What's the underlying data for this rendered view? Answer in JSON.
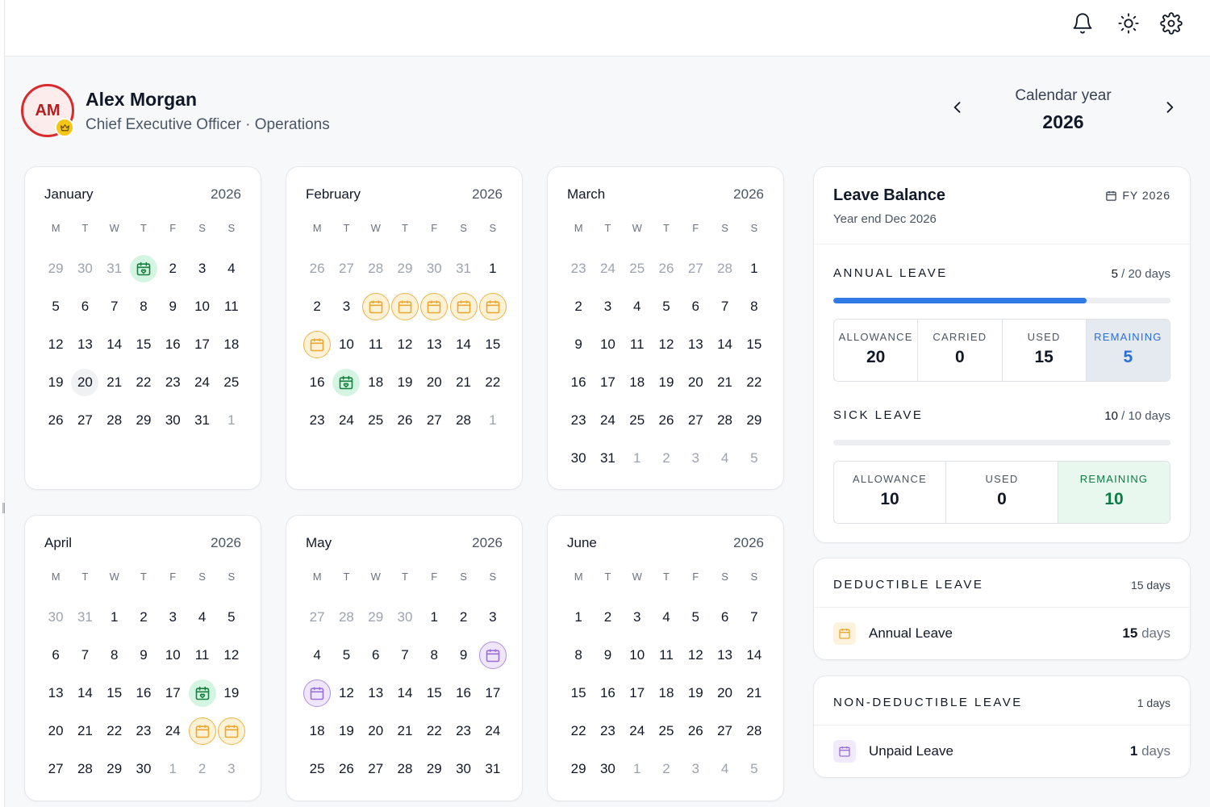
{
  "user": {
    "initials": "AM",
    "name": "Alex Morgan",
    "role": "Chief Executive Officer · Operations"
  },
  "year_nav": {
    "label": "Calendar year",
    "year": "2026"
  },
  "months": [
    {
      "name": "January",
      "year": "2026",
      "dow": [
        "M",
        "T",
        "W",
        "T",
        "F",
        "S",
        "S"
      ],
      "days": [
        {
          "d": "29",
          "m": true
        },
        {
          "d": "30",
          "m": true
        },
        {
          "d": "31",
          "m": true
        },
        {
          "d": "1",
          "t": "holiday"
        },
        {
          "d": "2"
        },
        {
          "d": "3"
        },
        {
          "d": "4"
        },
        {
          "d": "5"
        },
        {
          "d": "6"
        },
        {
          "d": "7"
        },
        {
          "d": "8"
        },
        {
          "d": "9"
        },
        {
          "d": "10"
        },
        {
          "d": "11"
        },
        {
          "d": "12"
        },
        {
          "d": "13"
        },
        {
          "d": "14"
        },
        {
          "d": "15"
        },
        {
          "d": "16"
        },
        {
          "d": "17"
        },
        {
          "d": "18"
        },
        {
          "d": "19"
        },
        {
          "d": "20",
          "t": "today"
        },
        {
          "d": "21"
        },
        {
          "d": "22"
        },
        {
          "d": "23"
        },
        {
          "d": "24"
        },
        {
          "d": "25"
        },
        {
          "d": "26"
        },
        {
          "d": "27"
        },
        {
          "d": "28"
        },
        {
          "d": "29"
        },
        {
          "d": "30"
        },
        {
          "d": "31"
        },
        {
          "d": "1",
          "m": true
        }
      ]
    },
    {
      "name": "February",
      "year": "2026",
      "dow": [
        "M",
        "T",
        "W",
        "T",
        "F",
        "S",
        "S"
      ],
      "days": [
        {
          "d": "26",
          "m": true
        },
        {
          "d": "27",
          "m": true
        },
        {
          "d": "28",
          "m": true
        },
        {
          "d": "29",
          "m": true
        },
        {
          "d": "30",
          "m": true
        },
        {
          "d": "31",
          "m": true
        },
        {
          "d": "1"
        },
        {
          "d": "2"
        },
        {
          "d": "3"
        },
        {
          "d": "4",
          "t": "annual"
        },
        {
          "d": "5",
          "t": "annual"
        },
        {
          "d": "6",
          "t": "annual"
        },
        {
          "d": "7",
          "t": "annual"
        },
        {
          "d": "8",
          "t": "annual"
        },
        {
          "d": "9",
          "t": "annual"
        },
        {
          "d": "10"
        },
        {
          "d": "11"
        },
        {
          "d": "12"
        },
        {
          "d": "13"
        },
        {
          "d": "14"
        },
        {
          "d": "15"
        },
        {
          "d": "16"
        },
        {
          "d": "17",
          "t": "holiday"
        },
        {
          "d": "18"
        },
        {
          "d": "19"
        },
        {
          "d": "20"
        },
        {
          "d": "21"
        },
        {
          "d": "22"
        },
        {
          "d": "23"
        },
        {
          "d": "24"
        },
        {
          "d": "25"
        },
        {
          "d": "26"
        },
        {
          "d": "27"
        },
        {
          "d": "28"
        },
        {
          "d": "1",
          "m": true
        }
      ]
    },
    {
      "name": "March",
      "year": "2026",
      "dow": [
        "M",
        "T",
        "W",
        "T",
        "F",
        "S",
        "S"
      ],
      "days": [
        {
          "d": "23",
          "m": true
        },
        {
          "d": "24",
          "m": true
        },
        {
          "d": "25",
          "m": true
        },
        {
          "d": "26",
          "m": true
        },
        {
          "d": "27",
          "m": true
        },
        {
          "d": "28",
          "m": true
        },
        {
          "d": "1"
        },
        {
          "d": "2"
        },
        {
          "d": "3"
        },
        {
          "d": "4"
        },
        {
          "d": "5"
        },
        {
          "d": "6"
        },
        {
          "d": "7"
        },
        {
          "d": "8"
        },
        {
          "d": "9"
        },
        {
          "d": "10"
        },
        {
          "d": "11"
        },
        {
          "d": "12"
        },
        {
          "d": "13"
        },
        {
          "d": "14"
        },
        {
          "d": "15"
        },
        {
          "d": "16"
        },
        {
          "d": "17"
        },
        {
          "d": "18"
        },
        {
          "d": "19"
        },
        {
          "d": "20"
        },
        {
          "d": "21"
        },
        {
          "d": "22"
        },
        {
          "d": "23"
        },
        {
          "d": "24"
        },
        {
          "d": "25"
        },
        {
          "d": "26"
        },
        {
          "d": "27"
        },
        {
          "d": "28"
        },
        {
          "d": "29"
        },
        {
          "d": "30"
        },
        {
          "d": "31"
        },
        {
          "d": "1",
          "m": true
        },
        {
          "d": "2",
          "m": true
        },
        {
          "d": "3",
          "m": true
        },
        {
          "d": "4",
          "m": true
        },
        {
          "d": "5",
          "m": true
        }
      ]
    },
    {
      "name": "April",
      "year": "2026",
      "dow": [
        "M",
        "T",
        "W",
        "T",
        "F",
        "S",
        "S"
      ],
      "days": [
        {
          "d": "30",
          "m": true
        },
        {
          "d": "31",
          "m": true
        },
        {
          "d": "1"
        },
        {
          "d": "2"
        },
        {
          "d": "3"
        },
        {
          "d": "4"
        },
        {
          "d": "5"
        },
        {
          "d": "6"
        },
        {
          "d": "7"
        },
        {
          "d": "8"
        },
        {
          "d": "9"
        },
        {
          "d": "10"
        },
        {
          "d": "11"
        },
        {
          "d": "12"
        },
        {
          "d": "13"
        },
        {
          "d": "14"
        },
        {
          "d": "15"
        },
        {
          "d": "16"
        },
        {
          "d": "17"
        },
        {
          "d": "18",
          "t": "holiday"
        },
        {
          "d": "19"
        },
        {
          "d": "20"
        },
        {
          "d": "21"
        },
        {
          "d": "22"
        },
        {
          "d": "23"
        },
        {
          "d": "24"
        },
        {
          "d": "25",
          "t": "annual"
        },
        {
          "d": "26",
          "t": "annual"
        },
        {
          "d": "27"
        },
        {
          "d": "28"
        },
        {
          "d": "29"
        },
        {
          "d": "30"
        },
        {
          "d": "1",
          "m": true
        },
        {
          "d": "2",
          "m": true
        },
        {
          "d": "3",
          "m": true
        }
      ]
    },
    {
      "name": "May",
      "year": "2026",
      "dow": [
        "M",
        "T",
        "W",
        "T",
        "F",
        "S",
        "S"
      ],
      "days": [
        {
          "d": "27",
          "m": true
        },
        {
          "d": "28",
          "m": true
        },
        {
          "d": "29",
          "m": true
        },
        {
          "d": "30",
          "m": true
        },
        {
          "d": "1"
        },
        {
          "d": "2"
        },
        {
          "d": "3"
        },
        {
          "d": "4"
        },
        {
          "d": "5"
        },
        {
          "d": "6"
        },
        {
          "d": "7"
        },
        {
          "d": "8"
        },
        {
          "d": "9"
        },
        {
          "d": "10",
          "t": "unpaid"
        },
        {
          "d": "11",
          "t": "unpaid"
        },
        {
          "d": "12"
        },
        {
          "d": "13"
        },
        {
          "d": "14"
        },
        {
          "d": "15"
        },
        {
          "d": "16"
        },
        {
          "d": "17"
        },
        {
          "d": "18"
        },
        {
          "d": "19"
        },
        {
          "d": "20"
        },
        {
          "d": "21"
        },
        {
          "d": "22"
        },
        {
          "d": "23"
        },
        {
          "d": "24"
        },
        {
          "d": "25"
        },
        {
          "d": "26"
        },
        {
          "d": "27"
        },
        {
          "d": "28"
        },
        {
          "d": "29"
        },
        {
          "d": "30"
        },
        {
          "d": "31"
        }
      ]
    },
    {
      "name": "June",
      "year": "2026",
      "dow": [
        "M",
        "T",
        "W",
        "T",
        "F",
        "S",
        "S"
      ],
      "days": [
        {
          "d": "1"
        },
        {
          "d": "2"
        },
        {
          "d": "3"
        },
        {
          "d": "4"
        },
        {
          "d": "5"
        },
        {
          "d": "6"
        },
        {
          "d": "7"
        },
        {
          "d": "8"
        },
        {
          "d": "9"
        },
        {
          "d": "10"
        },
        {
          "d": "11"
        },
        {
          "d": "12"
        },
        {
          "d": "13"
        },
        {
          "d": "14"
        },
        {
          "d": "15"
        },
        {
          "d": "16"
        },
        {
          "d": "17"
        },
        {
          "d": "18"
        },
        {
          "d": "19"
        },
        {
          "d": "20"
        },
        {
          "d": "21"
        },
        {
          "d": "22"
        },
        {
          "d": "23"
        },
        {
          "d": "24"
        },
        {
          "d": "25"
        },
        {
          "d": "26"
        },
        {
          "d": "27"
        },
        {
          "d": "28"
        },
        {
          "d": "29"
        },
        {
          "d": "30"
        },
        {
          "d": "1",
          "m": true
        },
        {
          "d": "2",
          "m": true
        },
        {
          "d": "3",
          "m": true
        },
        {
          "d": "4",
          "m": true
        },
        {
          "d": "5",
          "m": true
        }
      ]
    }
  ],
  "leave_balance": {
    "title": "Leave Balance",
    "subtitle": "Year end Dec 2026",
    "fy": "FY 2026",
    "annual": {
      "title": "ANNUAL LEAVE",
      "used": "5",
      "total": "/ 20 days",
      "progress": 0.75,
      "stats": [
        {
          "label": "ALLOWANCE",
          "value": "20"
        },
        {
          "label": "CARRIED",
          "value": "0"
        },
        {
          "label": "USED",
          "value": "15"
        },
        {
          "label": "REMAINING",
          "value": "5"
        }
      ]
    },
    "sick": {
      "title": "SICK LEAVE",
      "used": "10",
      "total": "/ 10 days",
      "progress": 0,
      "stats": [
        {
          "label": "ALLOWANCE",
          "value": "10"
        },
        {
          "label": "USED",
          "value": "0"
        },
        {
          "label": "REMAINING",
          "value": "10"
        }
      ]
    }
  },
  "deductible": {
    "title": "DEDUCTIBLE LEAVE",
    "total": "15 days",
    "item_label": "Annual Leave",
    "item_value": "15",
    "item_unit": "days"
  },
  "non_deductible": {
    "title": "NON-DEDUCTIBLE LEAVE",
    "total": "1 days",
    "item_label": "Unpaid Leave",
    "item_value": "1",
    "item_unit": "days"
  },
  "colors": {
    "accent_blue": "#2f7ae5",
    "holiday_green": "#d5f5e3",
    "annual_amber": "#e9b54a",
    "unpaid_purple": "#b08ee0",
    "avatar_red": "#d92b2b"
  }
}
